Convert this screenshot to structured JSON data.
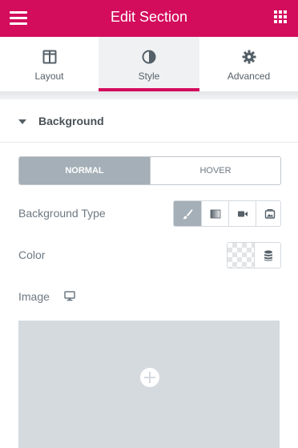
{
  "header": {
    "title": "Edit Section"
  },
  "tabs": [
    {
      "label": "Layout",
      "icon": "columns-icon"
    },
    {
      "label": "Style",
      "icon": "contrast-icon",
      "active": true
    },
    {
      "label": "Advanced",
      "icon": "gear-icon"
    }
  ],
  "section": {
    "title": "Background",
    "expanded": true
  },
  "state_toggle": {
    "normal": "NORMAL",
    "hover": "HOVER",
    "active": "NORMAL"
  },
  "controls": {
    "background_type": {
      "label": "Background Type",
      "options": [
        "brush-icon",
        "gradient-icon",
        "video-icon",
        "slideshow-icon"
      ],
      "selected": "brush-icon"
    },
    "color": {
      "label": "Color",
      "icons": [
        "transparent-swatch",
        "globals-stack-icon"
      ]
    },
    "image": {
      "label": "Image",
      "icon": "desktop-icon"
    }
  },
  "colors": {
    "accent": "#d30c5c",
    "active_toggle": "#a4afb7",
    "media_placeholder": "#d5dadf",
    "label_text": "#6d7882"
  }
}
